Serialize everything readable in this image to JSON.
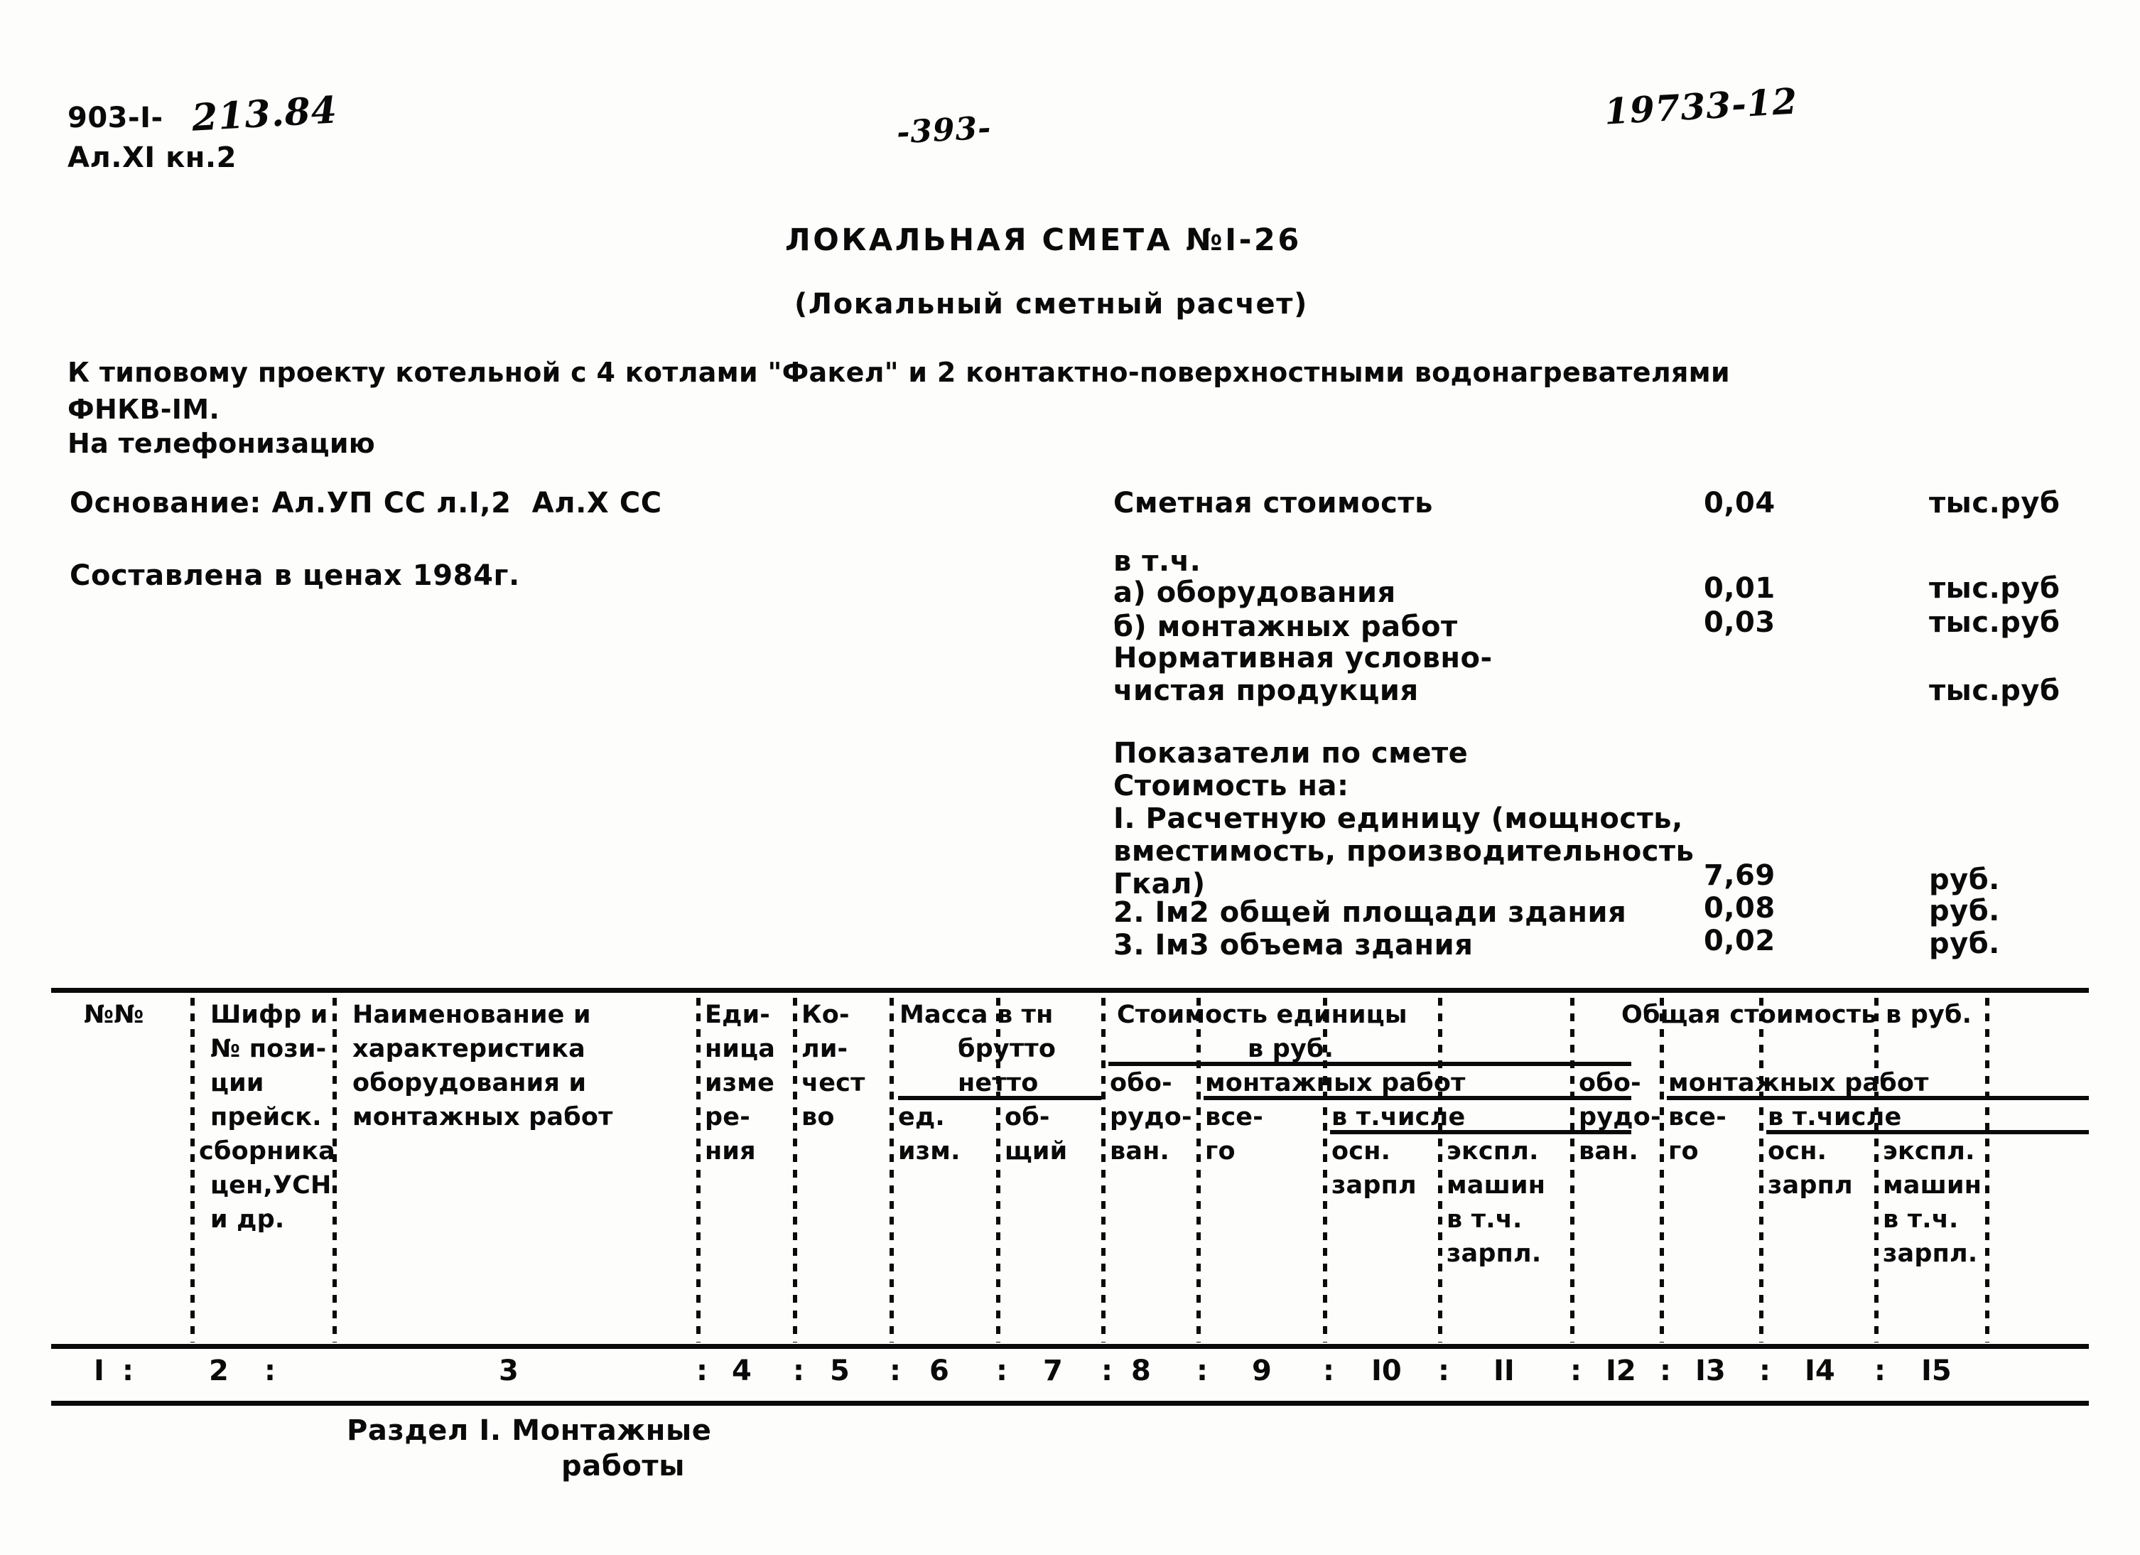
{
  "stamps": {
    "project_code_typed": "903-I-",
    "project_code_hand": "213.84",
    "album_line": "Ал.XI кн.2",
    "page_number": "-393-",
    "registration_number": "19733-12"
  },
  "titles": {
    "main": "ЛОКАЛЬНАЯ СМЕТА №I-26",
    "sub": "(Локальный сметный расчет)"
  },
  "intro": {
    "line1": "К типовому проекту котельной с 4 котлами \"Факел\" и 2 контактно-поверхностными водонагревателями",
    "line2": "ФНКВ-IМ.",
    "line3": "На телефонизацию"
  },
  "meta": {
    "basis": "Основание: Ал.УП СС л.I,2  Ал.X СС",
    "prices": "Составлена в ценах 1984г."
  },
  "summary": {
    "estimate_cost_label": "Сметная стоимость",
    "estimate_cost_value": "0,04",
    "estimate_cost_unit": "тыс.руб",
    "including_label": "в т.ч.",
    "equipment_label": "а) оборудования",
    "equipment_value": "0,01",
    "equipment_unit": "тыс.руб",
    "installation_label": "б) монтажных работ",
    "installation_value": "0,03",
    "installation_unit": "тыс.руб",
    "net_output_label_1": "Нормативная условно-",
    "net_output_label_2": "чистая продукция",
    "net_output_value": "",
    "net_output_unit": "тыс.руб",
    "indicators_title": "Показатели по смете",
    "cost_for_label": "Стоимость на:",
    "item1_line1": "I. Расчетную единицу (мощность,",
    "item1_line2": "вместимость, производительность",
    "item1_line3": "Гкал)",
    "item1_value": "7,69",
    "item1_unit": "руб.",
    "item2_label": "2. Iм2 общей площади здания",
    "item2_value": "0,08",
    "item2_unit": "руб.",
    "item3_label": "3. Iм3 объема здания",
    "item3_value": "0,02",
    "item3_unit": "руб."
  },
  "table": {
    "header": {
      "c1": "№№",
      "c2_l1": "Шифр и",
      "c2_l2": "№ пози-",
      "c2_l3": "ции",
      "c2_l4": "прейск.",
      "c2_l5": "сборника",
      "c2_l6": "цен,УСН",
      "c2_l7": "и др.",
      "c3_l1": "Наименование и",
      "c3_l2": "характеристика",
      "c3_l3": "оборудования и",
      "c3_l4": "монтажных работ",
      "c4_l1": "Еди-",
      "c4_l2": "ница",
      "c4_l3": "изме",
      "c4_l4": "ре-",
      "c4_l5": "ния",
      "c5_l1": "Ко-",
      "c5_l2": "ли-",
      "c5_l3": "чест",
      "c5_l4": "во",
      "mass_title": "Масса в тн",
      "mass_brutto": "брутто",
      "mass_netto": "нетто",
      "c6": "ед.",
      "c6b": "изм.",
      "c7": "об-",
      "c7b": "щий",
      "unit_cost_title": "Стоимость единицы",
      "unit_cost_sub": "в руб.",
      "c8": "обо-",
      "c8b": "рудо-",
      "c8c": "ван.",
      "inst_works_left": "монтажных работ",
      "c9": "все-",
      "c9b": "го",
      "in_which_left": "в т.числе",
      "c10": "осн.",
      "c10b": "зарпл",
      "c11": "экспл.",
      "c11b": "машин",
      "c11c": "в т.ч.",
      "c11d": "зарпл.",
      "total_cost_title": "Общая стоимость в руб.",
      "c12": "обо-",
      "c12b": "рудо-",
      "c12c": "ван.",
      "inst_works_right": "монтажных работ",
      "c13": "все-",
      "c13b": "го",
      "in_which_right": "в т.числе",
      "c14": "осн.",
      "c14b": "зарпл",
      "c15": "экспл.",
      "c15b": "машин",
      "c15c": "в т.ч.",
      "c15d": "зарпл."
    },
    "column_numbers": [
      "I",
      "2",
      "3",
      "4",
      "5",
      "6",
      "7",
      "8",
      "9",
      "I0",
      "II",
      "I2",
      "I3",
      "I4",
      "I5"
    ]
  },
  "section": {
    "line1": "Раздел I. Монтажные",
    "line2": "работы"
  }
}
